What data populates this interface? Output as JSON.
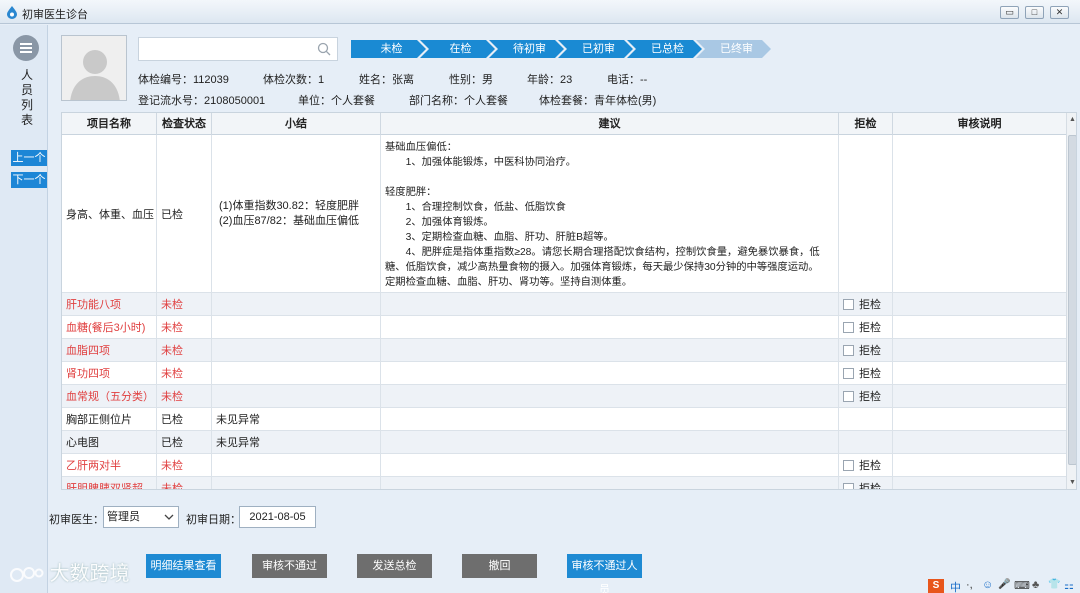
{
  "window": {
    "title": "初审医生诊台",
    "min": "▭",
    "max": "□",
    "close": "✕"
  },
  "sidebar": {
    "label": "人员列表",
    "prev": "上一个",
    "next": "下一个"
  },
  "search": {
    "placeholder": ""
  },
  "steps": [
    {
      "label": "未检",
      "color": "#1a8ad3"
    },
    {
      "label": "在检",
      "color": "#1a8ad3"
    },
    {
      "label": "待初审",
      "color": "#1a8ad3"
    },
    {
      "label": "已初审",
      "color": "#1a8ad3"
    },
    {
      "label": "已总检",
      "color": "#1a8ad3"
    },
    {
      "label": "已终审",
      "color": "#a9c8e4"
    }
  ],
  "patient": {
    "exam_no": "体检编号：112039",
    "exam_count": "体检次数：1",
    "name": "姓名：张离",
    "gender": "性别：男",
    "age": "年龄：23",
    "phone": "电话：--",
    "serial": "登记流水号：2108050001",
    "unit": "单位：个人套餐",
    "dept": "部门名称：个人套餐",
    "package": "体检套餐：青年体检(男)"
  },
  "table": {
    "headers": {
      "item": "项目名称",
      "status": "检查状态",
      "summary": "小结",
      "advice": "建议",
      "reject": "拒检",
      "note": "审核说明"
    },
    "first_row": {
      "item": "身高、体重、血压",
      "status": "已检",
      "summary": [
        "(1)体重指数30.82：轻度肥胖",
        "(2)血压87/82：基础血压偏低"
      ],
      "advice": [
        "基础血压偏低：",
        "　　1、加强体能锻炼，中医科协同治疗。",
        "",
        "轻度肥胖：",
        "　　1、合理控制饮食，低盐、低脂饮食",
        "　　2、加强体育锻炼。",
        "　　3、定期检查血糖、血脂、肝功、肝脏B超等。",
        "　　4、肥胖症是指体重指数≥28。请您长期合理搭配饮食结构，控制饮食量，避免暴饮暴食，低",
        "糖、低脂饮食，减少高热量食物的摄入。加强体育锻炼，每天最少保持30分钟的中等强度运动。",
        "定期检查血糖、血脂、肝功、肾功等。坚持自测体重。"
      ]
    },
    "reject_label": "拒检",
    "rows": [
      {
        "item": "肝功能八项",
        "status": "未检",
        "summary": "",
        "red": true,
        "reject": true
      },
      {
        "item": "血糖(餐后3小时)",
        "status": "未检",
        "summary": "",
        "red": true,
        "reject": true
      },
      {
        "item": "血脂四项",
        "status": "未检",
        "summary": "",
        "red": true,
        "reject": true
      },
      {
        "item": "肾功四项",
        "status": "未检",
        "summary": "",
        "red": true,
        "reject": true
      },
      {
        "item": "血常规（五分类）",
        "status": "未检",
        "summary": "",
        "red": true,
        "reject": true
      },
      {
        "item": "胸部正侧位片",
        "status": "已检",
        "summary": "未见异常",
        "red": false,
        "reject": false
      },
      {
        "item": "心电图",
        "status": "已检",
        "summary": "未见异常",
        "red": false,
        "reject": false
      },
      {
        "item": "乙肝两对半",
        "status": "未检",
        "summary": "",
        "red": true,
        "reject": true
      },
      {
        "item": "肝胆脾胰双肾超",
        "status": "未检",
        "summary": "",
        "red": true,
        "reject": true
      }
    ]
  },
  "form": {
    "doctor_label": "初审医生：",
    "doctor_value": "管理员",
    "date_label": "初审日期：",
    "date_value": "2021-08-05"
  },
  "actions": [
    {
      "label": "明细结果查看",
      "color": "#1e8ad3"
    },
    {
      "label": "审核不通过",
      "color": "#6e6e6e"
    },
    {
      "label": "发送总检",
      "color": "#6e6e6e"
    },
    {
      "label": "撤回",
      "color": "#6e6e6e"
    },
    {
      "label": "审核不通过人员",
      "color": "#1e8ad3"
    }
  ],
  "watermark": "大数跨境",
  "tray": [
    "中",
    "·,",
    "☺",
    "🎤",
    "⌨",
    "♣",
    "👕",
    "⚏"
  ]
}
